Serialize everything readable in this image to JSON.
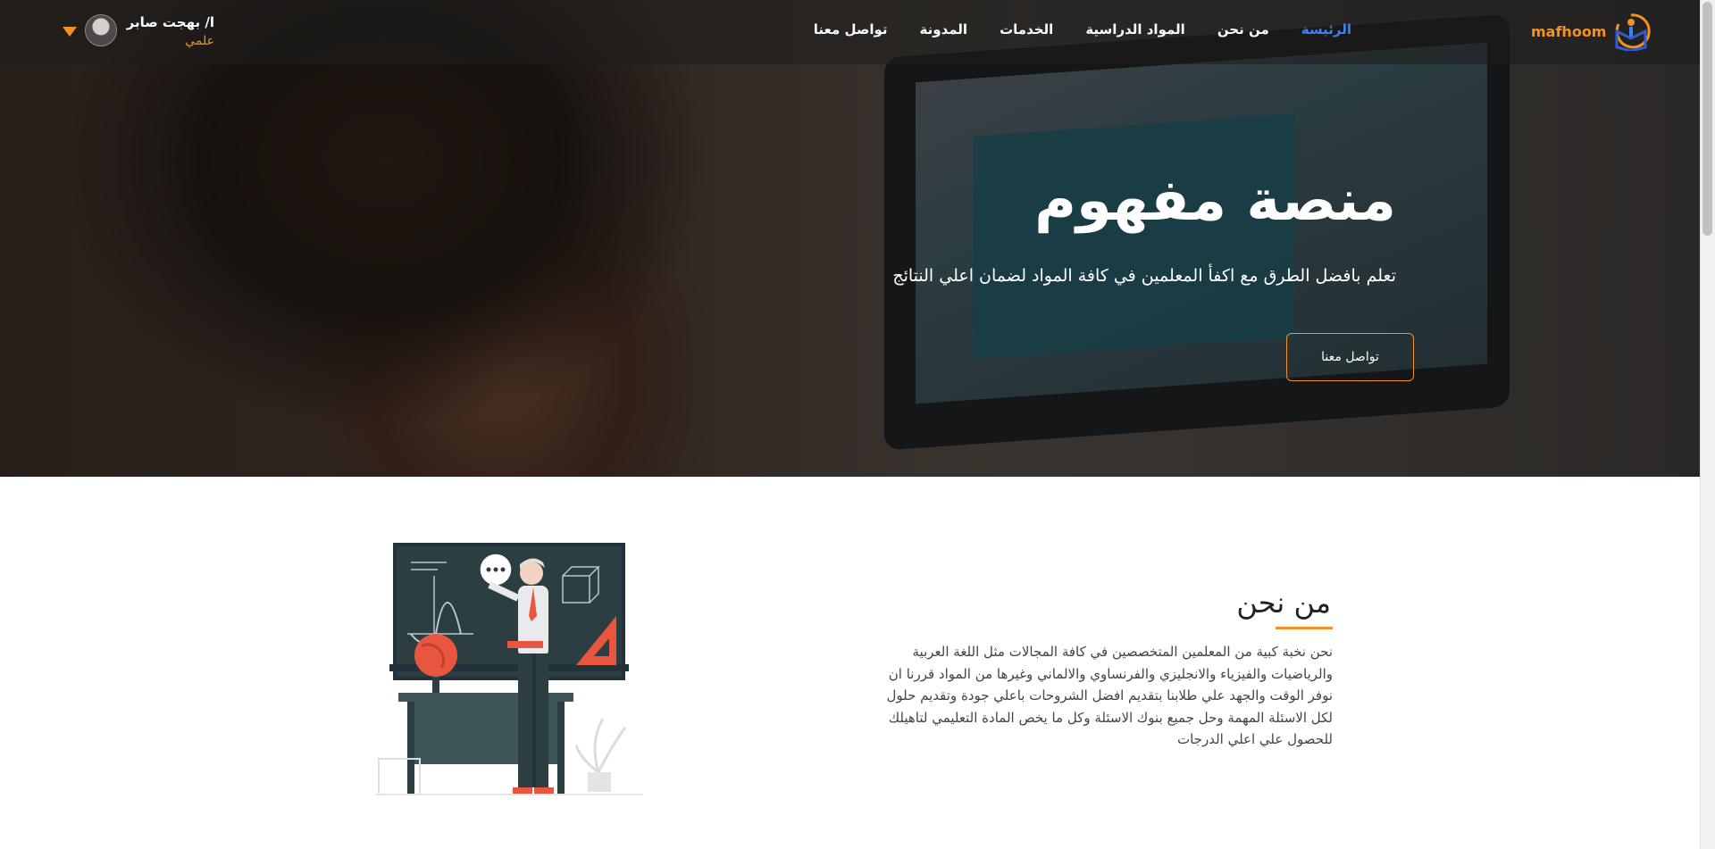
{
  "nav": {
    "logo_text": "mafhoom",
    "items": [
      {
        "label": "الرئيسة",
        "active": true
      },
      {
        "label": "من نحن",
        "active": false
      },
      {
        "label": "المواد الدراسية",
        "active": false
      },
      {
        "label": "الخدمات",
        "active": false
      },
      {
        "label": "المدونة",
        "active": false
      },
      {
        "label": "تواصل معنا",
        "active": false
      }
    ],
    "user": {
      "name": "ا/ بهجت صابر",
      "role": "علمي",
      "dropdown_icon": "caret-down-icon"
    }
  },
  "hero": {
    "title": "منصة مفهوم",
    "subtitle": "تعلم بافضل الطرق مع اكفأ المعلمين في كافة المواد لضمان اعلي النتائج",
    "cta_label": "تواصل معنا"
  },
  "about": {
    "title": "من نحن",
    "text": "نحن نخبة كبية من المعلمين المتخصصين في كافة المجالات مثل اللغة العربية والرياضيات والفيزياء والانجليزي والفرنساوي والالماني وغيرها من المواد قررنا ان نوفر الوقت والجهد علي طلابنا بتقديم افضل الشروحات باعلي جودة وتقديم حلول لكل الاسئلة المهمة وحل جميع بنوك الاسئلة وكل ما يخص المادة التعليمي لتاهيلك للحصول علي اعلي الدرجات"
  },
  "colors": {
    "accent": "#f39220",
    "active_link": "#3b82f6"
  }
}
